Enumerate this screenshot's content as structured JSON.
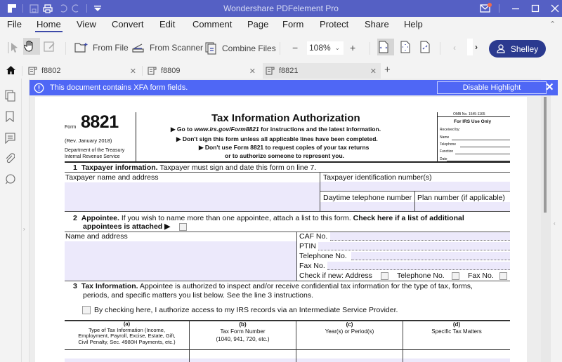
{
  "window": {
    "title": "Wondershare PDFelement Pro",
    "controls": [
      "minimize",
      "maximize",
      "close"
    ]
  },
  "quick_access": [
    "app-logo",
    "save-icon",
    "print-icon",
    "undo-icon",
    "redo-icon",
    "customize-dropdown-icon"
  ],
  "menu": {
    "items": [
      "File",
      "Home",
      "View",
      "Convert",
      "Edit",
      "Comment",
      "Page",
      "Form",
      "Protect",
      "Share",
      "Help"
    ],
    "active": "Home"
  },
  "toolbar": {
    "from_file": "From File",
    "from_scanner": "From Scanner",
    "combine_files": "Combine Files",
    "zoom_value": "108%",
    "zoom_minus": "−",
    "zoom_plus": "+",
    "user_name": "Shelley"
  },
  "tabs": [
    {
      "label": "f8802",
      "active": false
    },
    {
      "label": "f8809",
      "active": false
    },
    {
      "label": "f8821",
      "active": true
    }
  ],
  "tab_add": "+",
  "xfa_notice": {
    "message": "This document contains XFA form fields.",
    "button": "Disable Highlight",
    "close": "✕"
  },
  "form": {
    "form_label": "Form",
    "form_number": "8821",
    "revision": "(Rev. January 2018)",
    "dept_line1": "Department of the Treasury",
    "dept_line2": "Internal Revenue Service",
    "title": "Tax Information Authorization",
    "instr1_pre": "▶ Go to ",
    "instr1_link": "www.irs.gov/Form8821",
    "instr1_post": " for instructions and the latest information.",
    "instr2": "▶ Don't sign this form unless all applicable lines have been completed.",
    "instr3": "▶ Don't use Form 8821 to request copies of your tax returns",
    "instr4": "or to authorize someone to represent you.",
    "omb": "OMB No. 1545-1165",
    "irs_use": "For IRS Use Only",
    "received_by": "Received by:",
    "irs_name": "Name",
    "irs_telephone": "Telephone",
    "irs_function": "Function",
    "irs_date": "Date",
    "s1_num": "1",
    "s1_bold": "Taxpayer information.",
    "s1_text": " Taxpayer must sign and date this form on line 7.",
    "taxpayer_name_label": "Taxpayer name and address",
    "tin_label": "Taxpayer identification number(s)",
    "daytime_phone_label": "Daytime telephone number",
    "plan_number_label": "Plan number (if applicable)",
    "s2_num": "2",
    "s2_bold": "Appointee.",
    "s2_text": " If you wish to name more than one appointee, attach a list to this form. ",
    "s2_bold2": "Check here if a list of additional",
    "s2_line2": "appointees is attached ▶",
    "appointee_name_label": "Name and address",
    "caf_label": "CAF No.",
    "ptin_label": "PTIN",
    "telephone_label": "Telephone No.",
    "fax_label": "Fax No.",
    "check_new_label": "Check if new: Address",
    "check_new_tel": "Telephone No.",
    "check_new_fax": "Fax No.",
    "s3_num": "3",
    "s3_bold": "Tax Information.",
    "s3_text": " Appointee is authorized to inspect and/or receive confidential tax information for the type of tax, forms,",
    "s3_line2": "periods, and specific matters you list below. See the line 3 instructions.",
    "isp_checkbox_label": "By checking here, I authorize access to my IRS records via an Intermediate Service Provider.",
    "columns": [
      {
        "letter": "(a)",
        "lines": [
          "Type of Tax Information (Income,",
          "Employment, Payroll, Excise, Estate, Gift,",
          "Civil Penalty, Sec. 4980H Payments, etc.)"
        ]
      },
      {
        "letter": "(b)",
        "lines": [
          "Tax Form Number",
          "(1040, 941, 720, etc.)"
        ]
      },
      {
        "letter": "(c)",
        "lines": [
          "Year(s) or Period(s)"
        ]
      },
      {
        "letter": "(d)",
        "lines": [
          "Specific Tax Matters"
        ]
      }
    ]
  },
  "colors": {
    "titlebar": "#5560c4",
    "xfa_bar": "#4f67f5",
    "user_button": "#2b3a8f",
    "field_highlight": "#ece9fb"
  }
}
